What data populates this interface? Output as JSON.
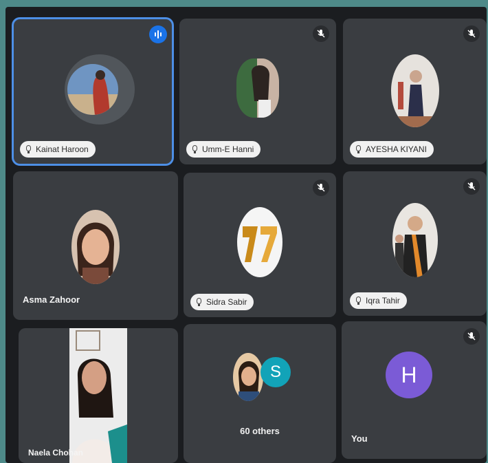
{
  "participants": [
    {
      "name": "Kainat Haroon",
      "state": "speaking"
    },
    {
      "name": "Umm-E Hanni",
      "state": "muted"
    },
    {
      "name": "AYESHA KIYANI",
      "state": "muted"
    },
    {
      "name": "Asma Zahoor",
      "state": "unmuted"
    },
    {
      "name": "Sidra Sabir",
      "state": "muted"
    },
    {
      "name": "Iqra Tahir",
      "state": "muted"
    },
    {
      "name": "Naela Chohan",
      "state": "unmuted"
    }
  ],
  "others": {
    "label": "60 others",
    "avatar_letter": "S"
  },
  "self": {
    "label": "You",
    "avatar_letter": "H",
    "state": "muted"
  },
  "colors": {
    "active_border": "#4d8fe6",
    "speaking_badge": "#1a73e8",
    "self_avatar": "#7b5bd6",
    "others_avatar": "#12a3b8"
  },
  "icons": {
    "speaking": "audio-wave-icon",
    "muted": "mic-off-icon",
    "nametag": "mic-icon"
  }
}
